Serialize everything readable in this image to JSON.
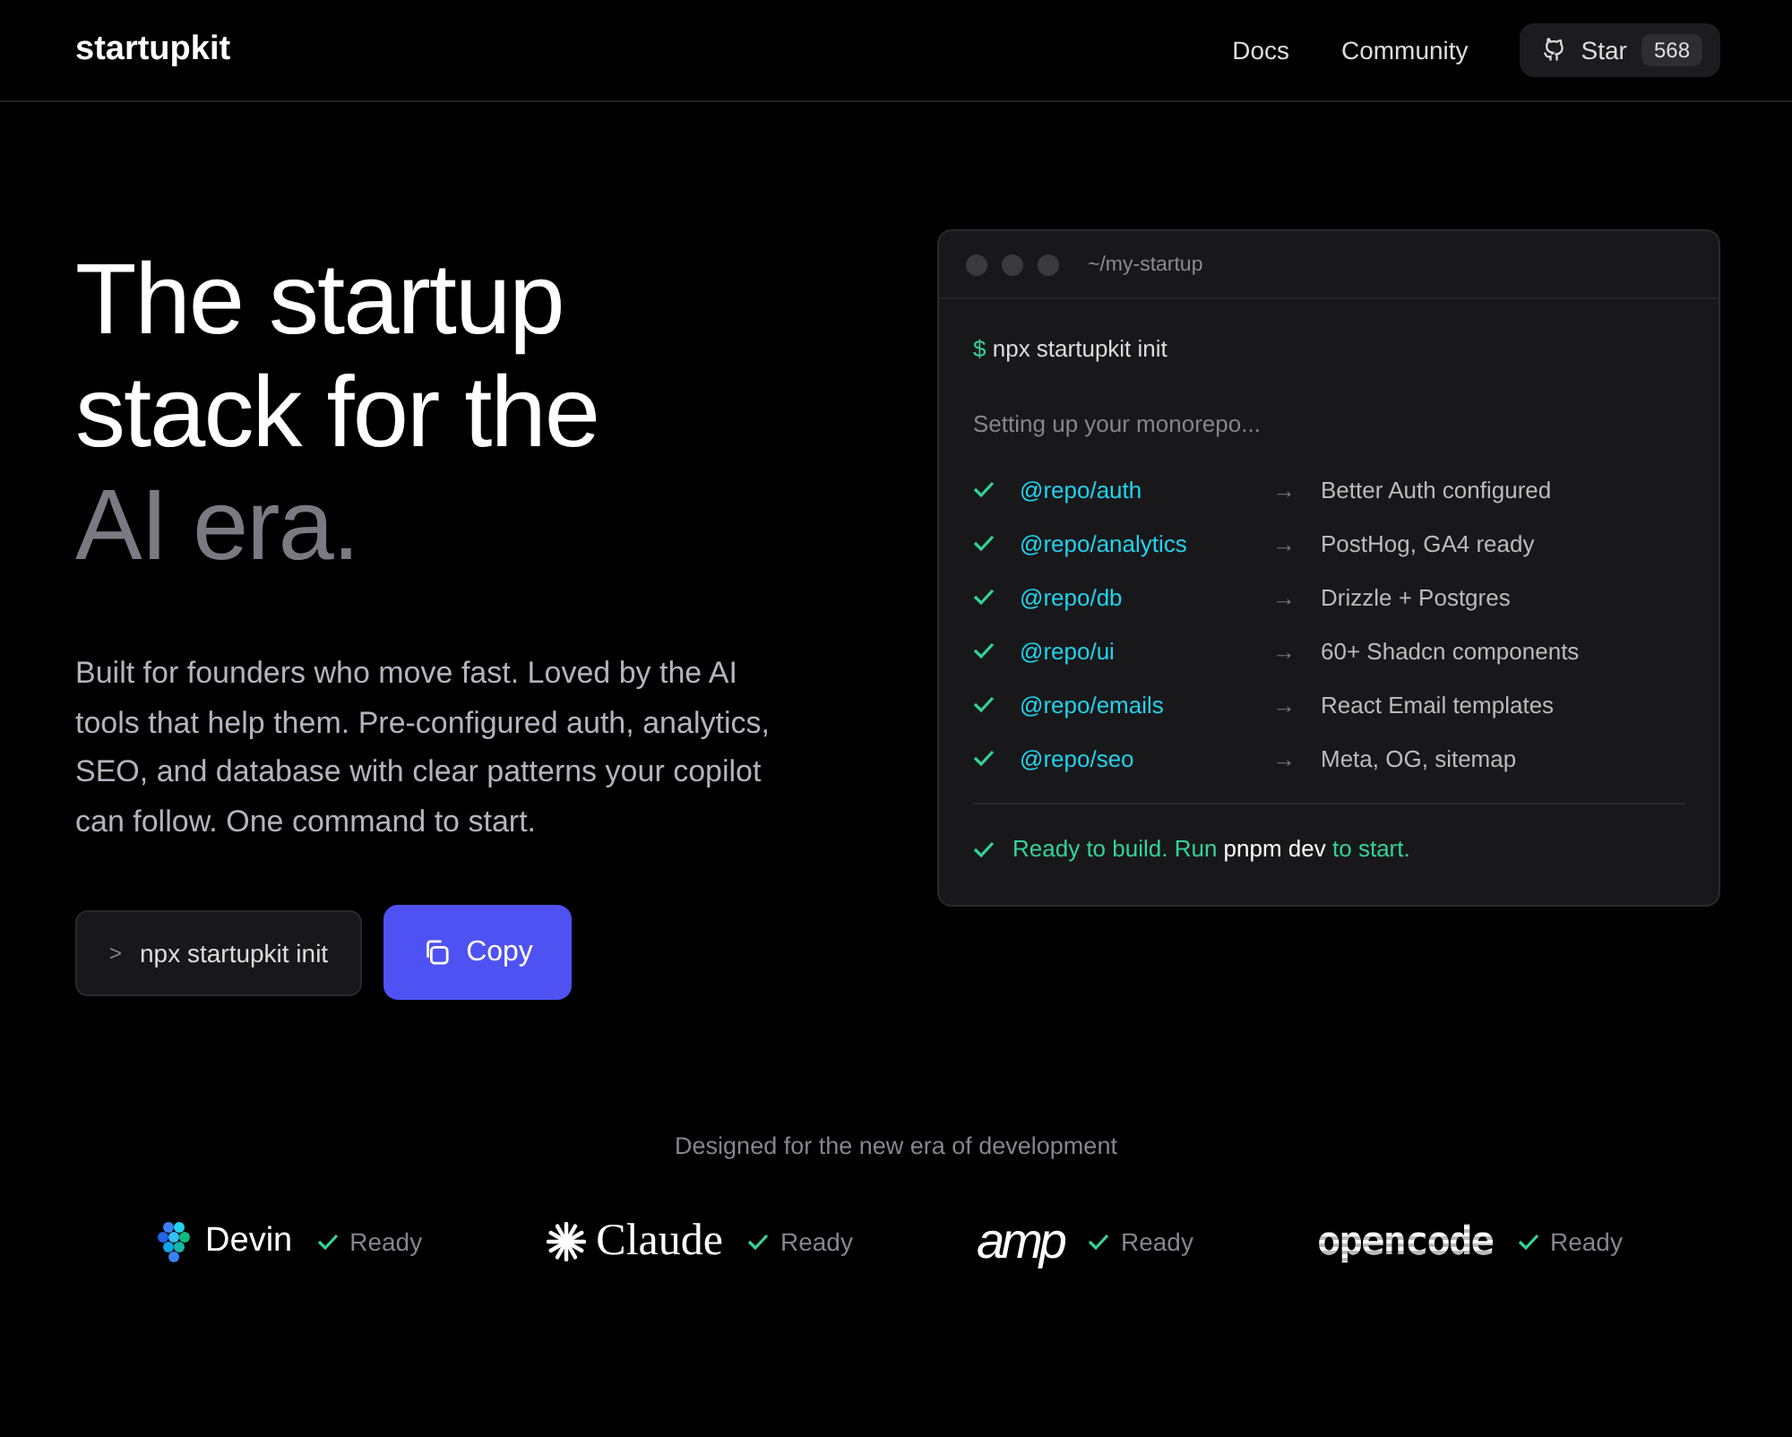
{
  "nav": {
    "brand": "startupkit",
    "links": [
      "Docs",
      "Community"
    ],
    "star": {
      "label": "Star",
      "count": "568"
    }
  },
  "hero": {
    "headline": [
      {
        "text": "The startup stack for the",
        "muted": false
      },
      {
        "text": "AI era.",
        "muted": true
      }
    ],
    "description": "Built for founders who move fast. Loved by the AI tools that help them. Pre-configured auth, analytics, SEO, and database with clear patterns your copilot can follow. One command to start.",
    "command": {
      "prompt": ">",
      "text": "npx startupkit init"
    },
    "copy_button": "Copy"
  },
  "terminal": {
    "title": "~/my-startup",
    "prompt": "$",
    "command": "npx startupkit init",
    "progress": "Setting up your monorepo...",
    "packages": [
      {
        "name": "@repo/auth",
        "arrow": "→",
        "result": "Better Auth configured",
        "done": true
      },
      {
        "name": "@repo/analytics",
        "arrow": "→",
        "result": "PostHog, GA4 ready",
        "done": true
      },
      {
        "name": "@repo/db",
        "arrow": "→",
        "result": "Drizzle + Postgres",
        "done": true
      },
      {
        "name": "@repo/ui",
        "arrow": "→",
        "result": "60+ Shadcn components",
        "done": true
      },
      {
        "name": "@repo/emails",
        "arrow": "→",
        "result": "React Email templates",
        "done": true
      },
      {
        "name": "@repo/seo",
        "arrow": "→",
        "result": "Meta, OG, sitemap",
        "done": true
      }
    ],
    "status": {
      "before": "Ready to build. Run",
      "command": "pnpm dev",
      "after": "to start."
    }
  },
  "tools": {
    "caption": "Designed for the new era of development",
    "items": [
      {
        "kind": "devin",
        "name": "Devin",
        "status": "Ready"
      },
      {
        "kind": "claude",
        "name": "Claude",
        "status": "Ready"
      },
      {
        "kind": "amp",
        "name": "amp",
        "status": "Ready"
      },
      {
        "kind": "opencode",
        "name": "opencode",
        "status": "Ready"
      }
    ]
  }
}
